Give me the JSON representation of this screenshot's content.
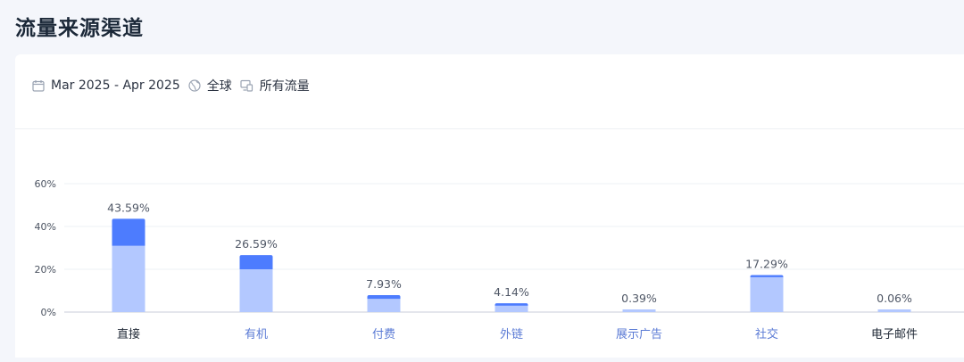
{
  "header": {
    "title": "流量来源渠道"
  },
  "filters": {
    "date_range": "Mar 2025 - Apr 2025",
    "region": "全球",
    "traffic": "所有流量"
  },
  "icons": {
    "calendar": "calendar-icon",
    "globe": "globe-icon",
    "traffic": "devices-icon"
  },
  "colors": {
    "bar_dark": "#4d7cfe",
    "bar_light": "#b3c8ff",
    "label_link": "#5b7bd5",
    "label_normal": "#222b38"
  },
  "chart_data": {
    "type": "bar",
    "stacked": true,
    "categories": [
      "直接",
      "有机",
      "付费",
      "外链",
      "展示广告",
      "社交",
      "电子邮件"
    ],
    "category_style": [
      "normal",
      "link",
      "link",
      "link",
      "link",
      "link",
      "normal"
    ],
    "values": [
      43.59,
      26.59,
      7.93,
      4.14,
      0.39,
      17.29,
      0.06
    ],
    "value_labels": [
      "43.59%",
      "26.59%",
      "7.93%",
      "4.14%",
      "0.39%",
      "17.29%",
      "0.06%"
    ],
    "series": [
      {
        "values": [
          31.0,
          20.0,
          6.2,
          3.0,
          0.39,
          16.3,
          0.06
        ]
      },
      {
        "values": [
          12.59,
          6.59,
          1.73,
          1.14,
          0,
          0.99,
          0
        ]
      }
    ],
    "yticks": [
      "0%",
      "20%",
      "40%",
      "60%"
    ],
    "ylim": [
      0,
      60
    ],
    "grid": true
  }
}
